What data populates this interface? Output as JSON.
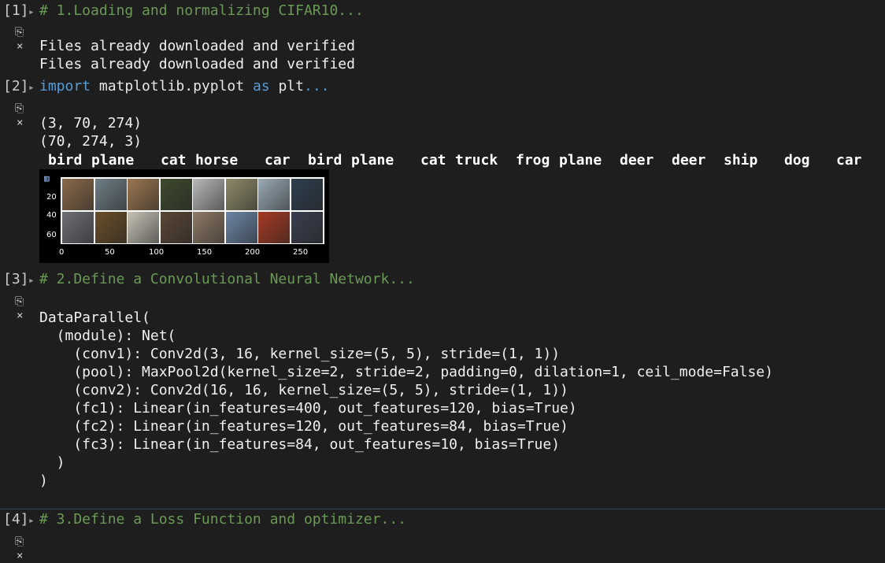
{
  "cells": [
    {
      "exec_label": "[1]",
      "code_comment": "# 1.Loading and normalizing CIFAR10...",
      "output_lines": [
        "Files already downloaded and verified",
        "Files already downloaded and verified"
      ]
    },
    {
      "exec_label": "[2]",
      "code_kw1": "import",
      "code_mid": " matplotlib.pyplot ",
      "code_kw2": "as",
      "code_end": " plt",
      "code_ellipsis": "...",
      "output_lines": [
        "(3, 70, 274)",
        "(70, 274, 3)"
      ],
      "labels": [
        "bird",
        "plane",
        "cat",
        "horse",
        "car",
        "bird",
        "plane",
        "cat",
        "truck",
        "frog",
        "plane",
        "deer",
        "deer",
        "ship",
        "dog",
        "car"
      ]
    },
    {
      "exec_label": "[3]",
      "code_comment": "# 2.Define a Convolutional Neural Network...",
      "output_lines": [
        "DataParallel(",
        "  (module): Net(",
        "    (conv1): Conv2d(3, 16, kernel_size=(5, 5), stride=(1, 1))",
        "    (pool): MaxPool2d(kernel_size=2, stride=2, padding=0, dilation=1, ceil_mode=False)",
        "    (conv2): Conv2d(16, 16, kernel_size=(5, 5), stride=(1, 1))",
        "    (fc1): Linear(in_features=400, out_features=120, bias=True)",
        "    (fc2): Linear(in_features=120, out_features=84, bias=True)",
        "    (fc3): Linear(in_features=84, out_features=10, bias=True)",
        "  )",
        ")"
      ]
    },
    {
      "exec_label": "[4]",
      "code_comment": "# 3.Define a Loss Function and optimizer..."
    }
  ],
  "plot": {
    "y_ticks": [
      "20",
      "40",
      "60"
    ],
    "x_ticks": [
      "0",
      "50",
      "100",
      "150",
      "200",
      "250"
    ],
    "tile_colors": [
      "#8a6a4a",
      "#6e7e86",
      "#9a7650",
      "#3e4a2e",
      "#b8b8b8",
      "#8f8a6a",
      "#9aaab6",
      "#2e3e4e",
      "#6e6e76",
      "#6a4e2a",
      "#c6c2b6",
      "#5a4636",
      "#8e7a66",
      "#6c86a6",
      "#a63a22",
      "#3a3e4e"
    ],
    "icon": "chart-icon"
  },
  "icons": {
    "copy": "copy-icon",
    "clear": "clear-output-icon",
    "expand": "chevron-right-icon"
  }
}
